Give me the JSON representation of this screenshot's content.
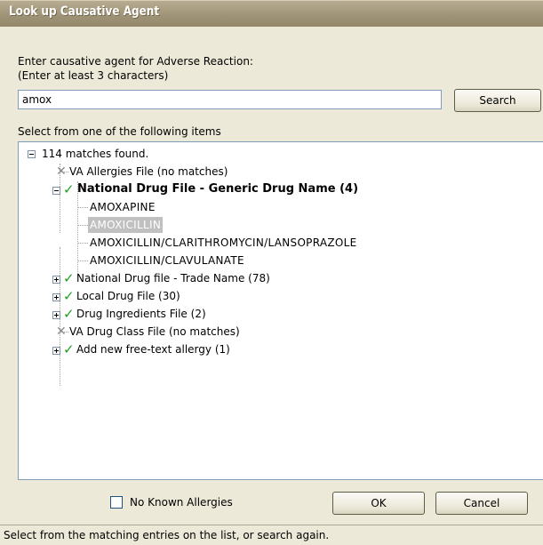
{
  "window": {
    "title": "Look up Causative Agent"
  },
  "prompt": {
    "line1": "Enter causative agent for Adverse Reaction:",
    "line2": "(Enter at least 3 characters)"
  },
  "search": {
    "value": "amox",
    "button_label": "Search"
  },
  "list_label": "Select from one of the following items",
  "tree": {
    "root": {
      "label": "114 matches found.",
      "expanded": true
    },
    "groups": [
      {
        "label": "VA Allergies File  (no matches)",
        "icon": "x-mark-icon",
        "expandable": false
      },
      {
        "label": "National Drug File - Generic Drug Name  (4)",
        "icon": "checkmark-icon",
        "expanded": true,
        "bold": true,
        "children": [
          "AMOXAPINE",
          "AMOXICILLIN",
          "AMOXICILLIN/CLARITHROMYCIN/LANSOPRAZOLE",
          "AMOXICILLIN/CLAVULANATE"
        ],
        "selected_child": "AMOXICILLIN"
      },
      {
        "label": "National Drug file - Trade Name  (78)",
        "icon": "checkmark-icon",
        "expanded": false
      },
      {
        "label": "Local Drug File  (30)",
        "icon": "checkmark-icon",
        "expanded": false
      },
      {
        "label": "Drug Ingredients File  (2)",
        "icon": "checkmark-icon",
        "expanded": false
      },
      {
        "label": "VA Drug Class File  (no matches)",
        "icon": "x-mark-icon",
        "expandable": false
      },
      {
        "label": "Add new free-text allergy  (1)",
        "icon": "checkmark-icon",
        "expanded": false
      }
    ]
  },
  "no_known_allergies": {
    "label": "No Known Allergies",
    "checked": false
  },
  "buttons": {
    "ok": "OK",
    "cancel": "Cancel"
  },
  "status": "Select from the matching entries on the list, or search again.",
  "colors": {
    "check": "#1fa11f",
    "title_bar": "#9f9377",
    "selection": "#c0c0c0"
  }
}
